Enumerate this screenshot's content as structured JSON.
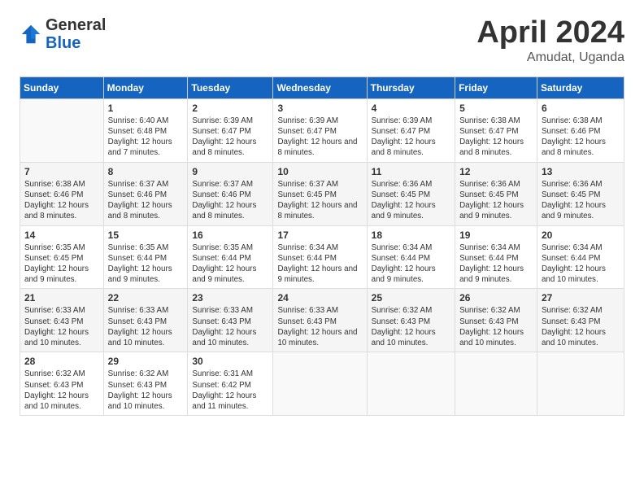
{
  "header": {
    "logo_general": "General",
    "logo_blue": "Blue",
    "month_title": "April 2024",
    "location": "Amudat, Uganda"
  },
  "days_of_week": [
    "Sunday",
    "Monday",
    "Tuesday",
    "Wednesday",
    "Thursday",
    "Friday",
    "Saturday"
  ],
  "weeks": [
    [
      {
        "day": "",
        "sunrise": "",
        "sunset": "",
        "daylight": ""
      },
      {
        "day": "1",
        "sunrise": "Sunrise: 6:40 AM",
        "sunset": "Sunset: 6:48 PM",
        "daylight": "Daylight: 12 hours and 7 minutes."
      },
      {
        "day": "2",
        "sunrise": "Sunrise: 6:39 AM",
        "sunset": "Sunset: 6:47 PM",
        "daylight": "Daylight: 12 hours and 8 minutes."
      },
      {
        "day": "3",
        "sunrise": "Sunrise: 6:39 AM",
        "sunset": "Sunset: 6:47 PM",
        "daylight": "Daylight: 12 hours and 8 minutes."
      },
      {
        "day": "4",
        "sunrise": "Sunrise: 6:39 AM",
        "sunset": "Sunset: 6:47 PM",
        "daylight": "Daylight: 12 hours and 8 minutes."
      },
      {
        "day": "5",
        "sunrise": "Sunrise: 6:38 AM",
        "sunset": "Sunset: 6:47 PM",
        "daylight": "Daylight: 12 hours and 8 minutes."
      },
      {
        "day": "6",
        "sunrise": "Sunrise: 6:38 AM",
        "sunset": "Sunset: 6:46 PM",
        "daylight": "Daylight: 12 hours and 8 minutes."
      }
    ],
    [
      {
        "day": "7",
        "sunrise": "Sunrise: 6:38 AM",
        "sunset": "Sunset: 6:46 PM",
        "daylight": "Daylight: 12 hours and 8 minutes."
      },
      {
        "day": "8",
        "sunrise": "Sunrise: 6:37 AM",
        "sunset": "Sunset: 6:46 PM",
        "daylight": "Daylight: 12 hours and 8 minutes."
      },
      {
        "day": "9",
        "sunrise": "Sunrise: 6:37 AM",
        "sunset": "Sunset: 6:46 PM",
        "daylight": "Daylight: 12 hours and 8 minutes."
      },
      {
        "day": "10",
        "sunrise": "Sunrise: 6:37 AM",
        "sunset": "Sunset: 6:45 PM",
        "daylight": "Daylight: 12 hours and 8 minutes."
      },
      {
        "day": "11",
        "sunrise": "Sunrise: 6:36 AM",
        "sunset": "Sunset: 6:45 PM",
        "daylight": "Daylight: 12 hours and 9 minutes."
      },
      {
        "day": "12",
        "sunrise": "Sunrise: 6:36 AM",
        "sunset": "Sunset: 6:45 PM",
        "daylight": "Daylight: 12 hours and 9 minutes."
      },
      {
        "day": "13",
        "sunrise": "Sunrise: 6:36 AM",
        "sunset": "Sunset: 6:45 PM",
        "daylight": "Daylight: 12 hours and 9 minutes."
      }
    ],
    [
      {
        "day": "14",
        "sunrise": "Sunrise: 6:35 AM",
        "sunset": "Sunset: 6:45 PM",
        "daylight": "Daylight: 12 hours and 9 minutes."
      },
      {
        "day": "15",
        "sunrise": "Sunrise: 6:35 AM",
        "sunset": "Sunset: 6:44 PM",
        "daylight": "Daylight: 12 hours and 9 minutes."
      },
      {
        "day": "16",
        "sunrise": "Sunrise: 6:35 AM",
        "sunset": "Sunset: 6:44 PM",
        "daylight": "Daylight: 12 hours and 9 minutes."
      },
      {
        "day": "17",
        "sunrise": "Sunrise: 6:34 AM",
        "sunset": "Sunset: 6:44 PM",
        "daylight": "Daylight: 12 hours and 9 minutes."
      },
      {
        "day": "18",
        "sunrise": "Sunrise: 6:34 AM",
        "sunset": "Sunset: 6:44 PM",
        "daylight": "Daylight: 12 hours and 9 minutes."
      },
      {
        "day": "19",
        "sunrise": "Sunrise: 6:34 AM",
        "sunset": "Sunset: 6:44 PM",
        "daylight": "Daylight: 12 hours and 9 minutes."
      },
      {
        "day": "20",
        "sunrise": "Sunrise: 6:34 AM",
        "sunset": "Sunset: 6:44 PM",
        "daylight": "Daylight: 12 hours and 10 minutes."
      }
    ],
    [
      {
        "day": "21",
        "sunrise": "Sunrise: 6:33 AM",
        "sunset": "Sunset: 6:43 PM",
        "daylight": "Daylight: 12 hours and 10 minutes."
      },
      {
        "day": "22",
        "sunrise": "Sunrise: 6:33 AM",
        "sunset": "Sunset: 6:43 PM",
        "daylight": "Daylight: 12 hours and 10 minutes."
      },
      {
        "day": "23",
        "sunrise": "Sunrise: 6:33 AM",
        "sunset": "Sunset: 6:43 PM",
        "daylight": "Daylight: 12 hours and 10 minutes."
      },
      {
        "day": "24",
        "sunrise": "Sunrise: 6:33 AM",
        "sunset": "Sunset: 6:43 PM",
        "daylight": "Daylight: 12 hours and 10 minutes."
      },
      {
        "day": "25",
        "sunrise": "Sunrise: 6:32 AM",
        "sunset": "Sunset: 6:43 PM",
        "daylight": "Daylight: 12 hours and 10 minutes."
      },
      {
        "day": "26",
        "sunrise": "Sunrise: 6:32 AM",
        "sunset": "Sunset: 6:43 PM",
        "daylight": "Daylight: 12 hours and 10 minutes."
      },
      {
        "day": "27",
        "sunrise": "Sunrise: 6:32 AM",
        "sunset": "Sunset: 6:43 PM",
        "daylight": "Daylight: 12 hours and 10 minutes."
      }
    ],
    [
      {
        "day": "28",
        "sunrise": "Sunrise: 6:32 AM",
        "sunset": "Sunset: 6:43 PM",
        "daylight": "Daylight: 12 hours and 10 minutes."
      },
      {
        "day": "29",
        "sunrise": "Sunrise: 6:32 AM",
        "sunset": "Sunset: 6:43 PM",
        "daylight": "Daylight: 12 hours and 10 minutes."
      },
      {
        "day": "30",
        "sunrise": "Sunrise: 6:31 AM",
        "sunset": "Sunset: 6:42 PM",
        "daylight": "Daylight: 12 hours and 11 minutes."
      },
      {
        "day": "",
        "sunrise": "",
        "sunset": "",
        "daylight": ""
      },
      {
        "day": "",
        "sunrise": "",
        "sunset": "",
        "daylight": ""
      },
      {
        "day": "",
        "sunrise": "",
        "sunset": "",
        "daylight": ""
      },
      {
        "day": "",
        "sunrise": "",
        "sunset": "",
        "daylight": ""
      }
    ]
  ]
}
